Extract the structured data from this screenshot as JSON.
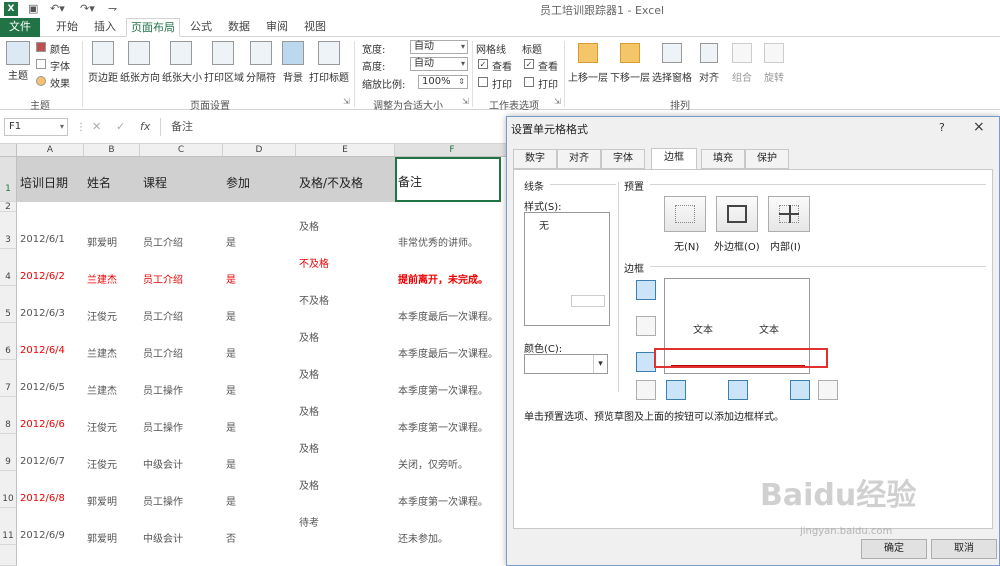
{
  "app": {
    "window_title": "员工培训跟踪器1 - Excel",
    "excel_logo": "X"
  },
  "tabs": [
    {
      "label": "文件"
    },
    {
      "label": "开始"
    },
    {
      "label": "插入"
    },
    {
      "label": "页面布局"
    },
    {
      "label": "公式"
    },
    {
      "label": "数据"
    },
    {
      "label": "审阅"
    },
    {
      "label": "视图"
    }
  ],
  "ribbon": {
    "theme_group": {
      "name": "主题",
      "theme_label": "主题",
      "colors_label": "颜色",
      "fonts_label": "字体",
      "effects_label": "效果"
    },
    "page_setup_group": {
      "name": "页面设置",
      "buttons": [
        "页边距",
        "纸张方向",
        "纸张大小",
        "打印区域",
        "分隔符",
        "背景",
        "打印标题"
      ]
    },
    "scale_group": {
      "name": "调整为合适大小",
      "width_label": "宽度:",
      "width_value": "自动",
      "height_label": "高度:",
      "height_value": "自动",
      "scale_label": "缩放比例:",
      "scale_value": "100%"
    },
    "sheet_options_group": {
      "name": "工作表选项",
      "gridlines_label": "网格线",
      "headings_label": "标题",
      "view_label": "查看",
      "print_label": "打印"
    },
    "arrange_group": {
      "name": "排列",
      "buttons": [
        "上移一层",
        "下移一层",
        "选择窗格",
        "对齐",
        "组合",
        "旋转"
      ]
    }
  },
  "formula_bar": {
    "name_box": "F1",
    "fx": "fx",
    "content": "备注"
  },
  "grid": {
    "columns": [
      "A",
      "B",
      "C",
      "D",
      "E",
      "F"
    ],
    "header_row": [
      "培训日期",
      "姓名",
      "课程",
      "参加",
      "及格/不及格",
      "备注"
    ],
    "row_numbers": [
      "1",
      "2",
      "3",
      "4",
      "5",
      "6",
      "7",
      "8",
      "9",
      "10",
      "11"
    ],
    "rows": [
      {
        "date": "2012/6/1",
        "name": "郭爱明",
        "course": "员工介绍",
        "attend": "是",
        "pass": "及格",
        "note": "非常优秀的讲师。",
        "red": false
      },
      {
        "date": "2012/6/2",
        "name": "兰建杰",
        "course": "员工介绍",
        "attend": "是",
        "pass": "不及格",
        "note": "提前离开，未完成。",
        "red": true
      },
      {
        "date": "2012/6/3",
        "name": "汪俊元",
        "course": "员工介绍",
        "attend": "是",
        "pass": "不及格",
        "note": "本季度最后一次课程。",
        "red": false
      },
      {
        "date": "2012/6/4",
        "name": "兰建杰",
        "course": "员工介绍",
        "attend": "是",
        "pass": "及格",
        "note": "本季度最后一次课程。",
        "red": false,
        "date_red": true
      },
      {
        "date": "2012/6/5",
        "name": "兰建杰",
        "course": "员工操作",
        "attend": "是",
        "pass": "及格",
        "note": "本季度第一次课程。",
        "red": false
      },
      {
        "date": "2012/6/6",
        "name": "汪俊元",
        "course": "员工操作",
        "attend": "是",
        "pass": "及格",
        "note": "本季度第一次课程。",
        "red": false,
        "date_red": true
      },
      {
        "date": "2012/6/7",
        "name": "汪俊元",
        "course": "中级会计",
        "attend": "是",
        "pass": "及格",
        "note": "关闭，仅旁听。",
        "red": false
      },
      {
        "date": "2012/6/8",
        "name": "郭爱明",
        "course": "员工操作",
        "attend": "是",
        "pass": "及格",
        "note": "本季度第一次课程。",
        "red": false,
        "date_red": true
      },
      {
        "date": "2012/6/9",
        "name": "郭爱明",
        "course": "中级会计",
        "attend": "否",
        "pass": "待考",
        "note": "还未参加。",
        "red": false
      }
    ]
  },
  "dialog": {
    "title": "设置单元格格式",
    "help": "?",
    "close": "×",
    "tabs": [
      "数字",
      "对齐",
      "字体",
      "边框",
      "填充",
      "保护"
    ],
    "active_tab": "边框",
    "line_section": "线条",
    "style_label": "样式(S):",
    "style_none": "无",
    "color_label": "颜色(C):",
    "preset_section": "预置",
    "preset_none": "无(N)",
    "preset_outline": "外边框(O)",
    "preset_inside": "内部(I)",
    "border_section": "边框",
    "preview_text_1": "文本",
    "preview_text_2": "文本",
    "hint": "单击预置选项、预览草图及上面的按钮可以添加边框样式。",
    "ok": "确定",
    "cancel": "取消",
    "highlight_color": "#e03030",
    "border_line_color": "#c00000"
  },
  "watermark": {
    "brand": "Baidu经验",
    "url": "jingyan.baidu.com"
  }
}
